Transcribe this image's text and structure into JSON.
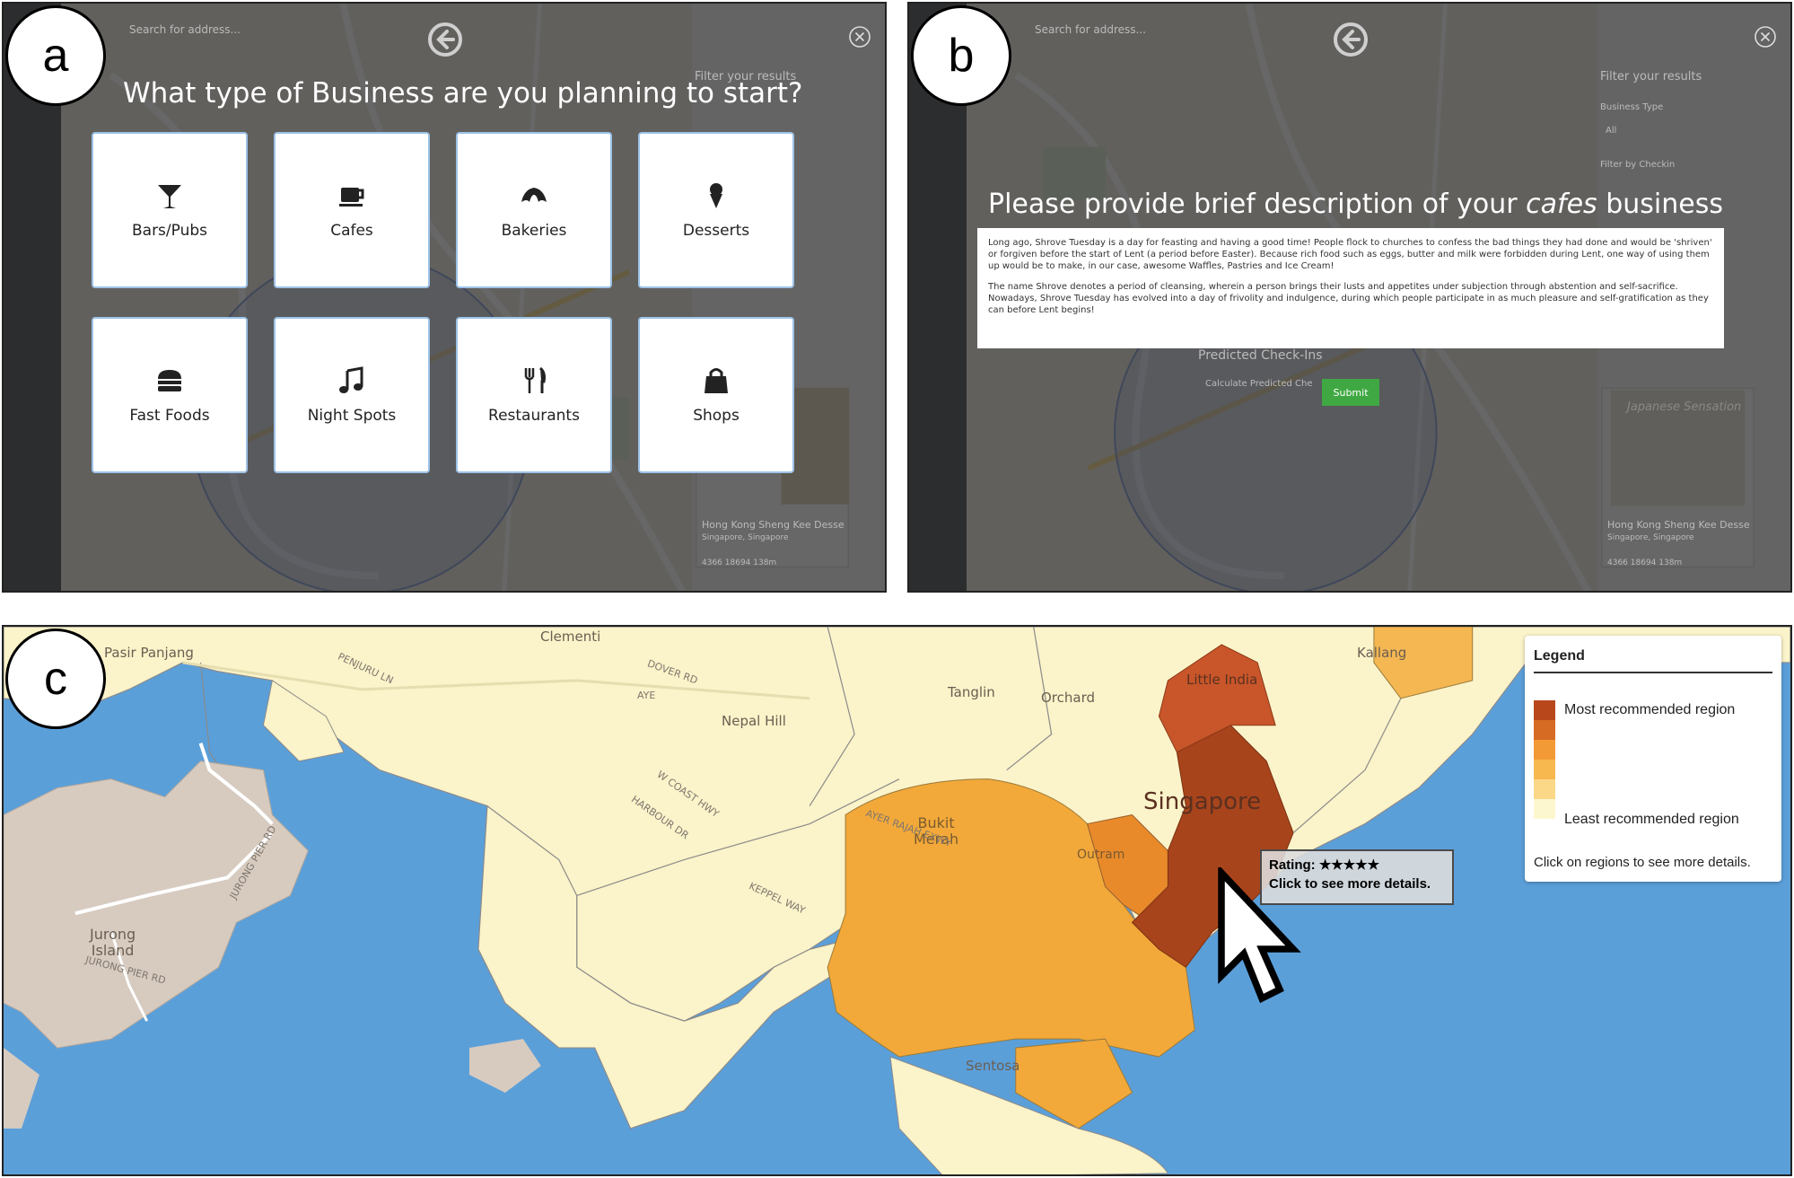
{
  "panels": {
    "a": "a",
    "b": "b",
    "c": "c"
  },
  "panel_a": {
    "heading": "What type of Business are you planning to start?",
    "tiles": [
      {
        "label": "Bars/Pubs",
        "icon": "cocktail-icon"
      },
      {
        "label": "Cafes",
        "icon": "coffee-cup-icon"
      },
      {
        "label": "Bakeries",
        "icon": "croissant-icon"
      },
      {
        "label": "Desserts",
        "icon": "ice-cream-icon"
      },
      {
        "label": "Fast Foods",
        "icon": "burger-icon"
      },
      {
        "label": "Night Spots",
        "icon": "music-note-icon"
      },
      {
        "label": "Restaurants",
        "icon": "fork-knife-icon"
      },
      {
        "label": "Shops",
        "icon": "shopping-bag-icon"
      }
    ],
    "bg": {
      "search_placeholder": "Search for address...",
      "filter_label": "Filter your results",
      "card_title": "Hong Kong Sheng Kee Desse",
      "card_sub": "Singapore, Singapore",
      "card_stats": "4366  18694  138m"
    }
  },
  "panel_b": {
    "heading_pre": "Please provide brief description of your ",
    "heading_em": "cafes",
    "heading_post": " business",
    "paragraph1": "Long ago, Shrove Tuesday is a day for feasting and having a good time! People flock to churches to confess the bad things they had done and would be 'shriven' or forgiven before the start of Lent (a period before Easter). Because rich food such as eggs, butter and milk were forbidden during Lent, one way of using them up would be to make, in our case, awesome Waffles, Pastries and Ice Cream!",
    "paragraph2": "The name Shrove denotes a period of cleansing, wherein a person brings their lusts and appetites under subjection through abstention and self-sacrifice. Nowadays, Shrove Tuesday has evolved into a day of frivolity and indulgence, during which people participate in as much pleasure and self-gratification as they can before Lent begins!",
    "submit_label": "Submit",
    "bg": {
      "search_placeholder": "Search for address...",
      "filter_label": "Filter your results",
      "business_type_label": "Business Type",
      "business_type_value": "All",
      "checkin_label": "Filter by Checkin",
      "predicted_label": "Predicted Check-Ins",
      "calc_label": "Calculate Predicted Che",
      "card_title": "Hong Kong Sheng Kee Desse",
      "card_sub": "Singapore, Singapore",
      "card_stats": "4366  18694  138m",
      "card_image_text": "Japanese Sensation"
    }
  },
  "panel_c": {
    "legend": {
      "title": "Legend",
      "most": "Most recommended region",
      "least": "Least recommended region",
      "hint": "Click on regions to see more details.",
      "colors": [
        "#b8481c",
        "#d66b24",
        "#f29a36",
        "#f7b850",
        "#fbd888",
        "#fdf7cf"
      ]
    },
    "tooltip": {
      "rating_label": "Rating:",
      "stars": "★★★★★",
      "cta": "Click to see more details."
    },
    "places": {
      "jurong_island": "Jurong\nIsland",
      "jurong_pier_rd": "JURONG PIER RD",
      "jurong_pier_rd2": "JURONG PIER RD",
      "singapore": "Singapore",
      "bukit_merah": "Bukit\nMerah",
      "outram": "Outram",
      "sentosa": "Sentosa",
      "tanglin": "Tanglin",
      "orchard": "Orchard",
      "little_india": "Little India",
      "kallang": "Kallang",
      "clementi": "Clementi",
      "nepal_hill": "Nepal Hill",
      "pasir_panjang": "Pasir Panjang",
      "harbour_dr": "HARBOUR DR",
      "w_coast_hwy": "W COAST HWY",
      "keppel_way": "KEPPEL WAY",
      "ayer_rajah": "AYER RAJAH EXWY",
      "penjuru_ln": "PENJURU LN",
      "dover_rd": "DOVER RD",
      "aye": "AYE"
    }
  }
}
